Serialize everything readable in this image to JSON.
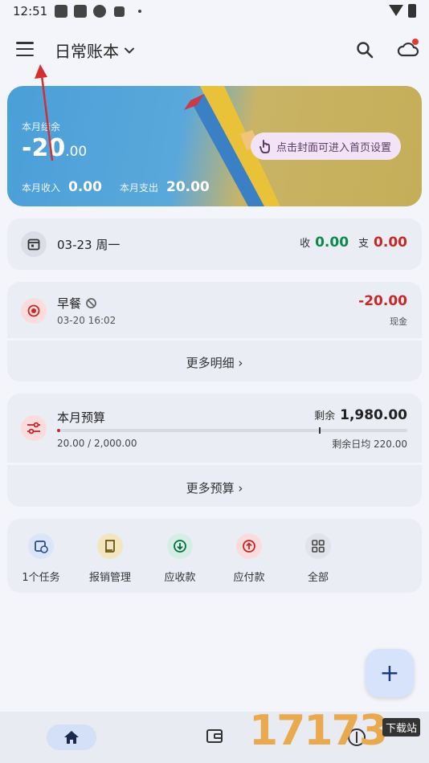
{
  "status_bar": {
    "time": "12:51"
  },
  "header": {
    "title": "日常账本"
  },
  "cover": {
    "balance_label": "本月结余",
    "balance_int": "-20",
    "balance_dec": ".00",
    "income_label": "本月收入",
    "income_value": "0.00",
    "expense_label": "本月支出",
    "expense_value": "20.00",
    "hint": "点击封面可进入首页设置"
  },
  "day_summary": {
    "date": "03-23 周一",
    "income_label": "收",
    "income_value": "0.00",
    "expense_label": "支",
    "expense_value": "0.00"
  },
  "record": {
    "title": "早餐",
    "time": "03-20 16:02",
    "amount": "-20.00",
    "method": "现金",
    "more_label": "更多明细"
  },
  "budget": {
    "title": "本月预算",
    "remain_label": "剩余",
    "remain_value": "1,980.00",
    "used_total": "20.00 / 2,000.00",
    "daily_avg": "剩余日均 220.00",
    "used_fraction": 0.01,
    "more_label": "更多预算"
  },
  "tools": [
    {
      "label": "1个任务",
      "icon": "calendar-clock-icon",
      "color": "#dbe5fa"
    },
    {
      "label": "报销管理",
      "icon": "receipt-icon",
      "color": "#f3e6bf"
    },
    {
      "label": "应收款",
      "icon": "arrow-down-circle-icon",
      "color": "#d6efe6"
    },
    {
      "label": "应付款",
      "icon": "arrow-up-circle-icon",
      "color": "#fbdcdc"
    },
    {
      "label": "全部",
      "icon": "grid-icon",
      "color": "#e1e3ea"
    }
  ],
  "fab": {
    "label": "+"
  },
  "watermark": {
    "text": "17173",
    "tag": "下载站"
  }
}
